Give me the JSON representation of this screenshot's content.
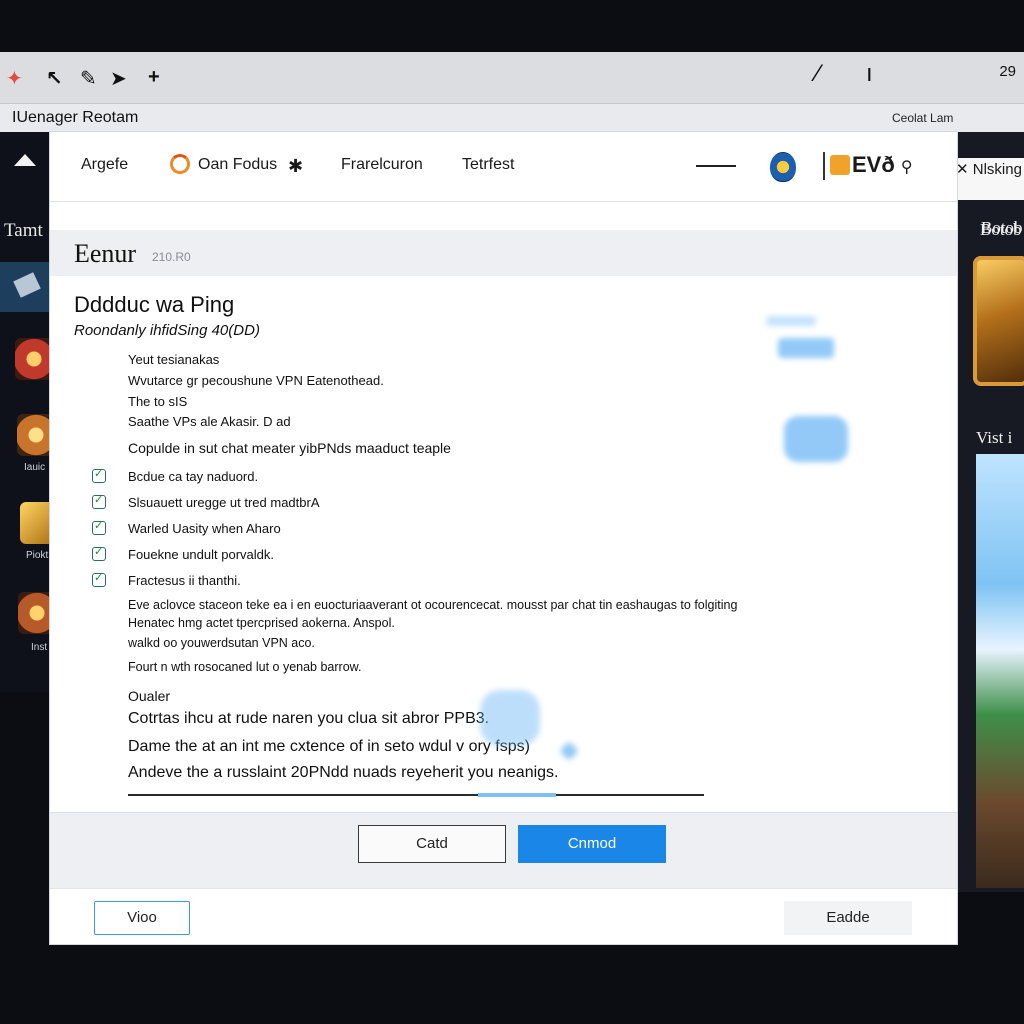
{
  "topbar": {
    "icons": [
      "app-color-icon",
      "arrow-icon",
      "edit-icon",
      "pointer-icon",
      "plus-icon"
    ],
    "minimize_symbol": "⁄",
    "pipe_symbol": "ı",
    "clock": "29"
  },
  "subtitlebar": {
    "app_title": "IUenager Reotam",
    "right_label": "Ceolat Lam"
  },
  "launcher": {
    "section_label": "Tamt",
    "tiles": [
      {
        "label": "",
        "color": "#c0392b"
      },
      {
        "label": "Iauic",
        "color": "#c8742a"
      },
      {
        "label": "Piokt",
        "color": "#d9a02c"
      },
      {
        "label": "Inst",
        "color": "#b65a2a"
      }
    ]
  },
  "tabs": {
    "items": [
      "Argefe",
      "Oan Fodus",
      "Frarelcuron",
      "Tetrfest"
    ],
    "evo_label": "EVð",
    "search_label": "Nlsking"
  },
  "gamepanel": {
    "head_label": "Botob",
    "label1": "Botob",
    "label2": "Vist i"
  },
  "section": {
    "title": "Eenur",
    "subtitle": "210.R0"
  },
  "content": {
    "heading": "Dddduc wa Ping",
    "subheading": "Roondanly ihfidSing 40(DD)",
    "lines": [
      "Yeut tesianakas",
      "Wvutarce gr pecoushune VPN Eatenothead.",
      "The to sIS",
      "Saathe VPs ale Akasir. D ad"
    ],
    "intro": "Copulde in sut chat meater yibPNds maaduct teaple",
    "checklist": [
      "Bcdue ca tay naduord.",
      "Slsuauett uregge ut tred madtbrA",
      "Warled Uasity when Aharo",
      "Fouekne undult porvaldk.",
      "Fractesus ii thanthi."
    ],
    "paragraph": [
      "Eve aclovce staceon teke ea i en euocturiaaverant ot ocourencecat. mousst par chat tin eashaugas to folgiting",
      "Henatec hmg actet tpercprised aokerna. Anspol.",
      "walkd oo youwerdsutan VPN aco.",
      "Fourt n wth rosocaned lut o yenab barrow."
    ],
    "oualer": "Oualer",
    "bullets": [
      "Cotrtas ihcu at rude naren you clua sit abror PPB3.",
      "Dame the at an int me cxtence of in seto wdul v ory fsps)",
      "Andeve the a russlaint 20PNdd nuads reyeherit you neanigs."
    ],
    "progress": 0.75
  },
  "buttons": {
    "cancel_label": "Catd",
    "confirm_label": "Cnmod",
    "view_label": "Vioo",
    "eade_label": "Eadde"
  },
  "colors": {
    "accent": "#1a86e8",
    "outline": "#3c9fc7",
    "check": "#1d8a3a"
  }
}
